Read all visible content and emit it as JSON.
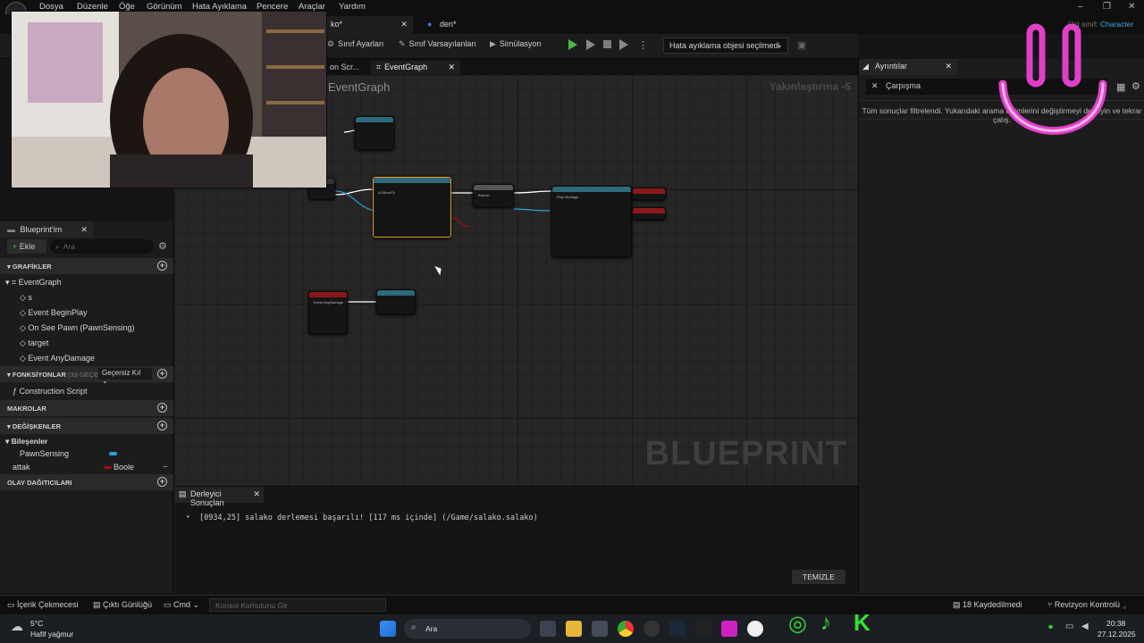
{
  "menubar": {
    "items": [
      "Dosya",
      "Düzenle",
      "Öğe",
      "Görünüm",
      "Hata Ayıklama",
      "Pencere",
      "Araçlar",
      "Yardım"
    ]
  },
  "tabs": {
    "asset_tab": "ko*",
    "den_tab": "den*",
    "parent_class_label": "Üst sınıf:",
    "parent_class_value": "Character"
  },
  "toolbar": {
    "class_settings": "Sınıf Ayarları",
    "class_defaults": "Sınıf Varsayılanları",
    "simulation": "Simülasyon",
    "debug_object": "Hata ayıklama objesi seçilmedi"
  },
  "graph_tabs": {
    "construction": "on Scr...",
    "event_graph": "EventGraph"
  },
  "graph": {
    "title": "EventGraph",
    "zoom": "Yakınlaştırma -5",
    "watermark": "BLUEPRINT",
    "nodes": {
      "event_begin_play": "Event AnyDamage",
      "ai_move_to": "AI MoveTo",
      "branch": "Branch",
      "play_montage": "Play Montage"
    }
  },
  "details": {
    "tab": "Ayrıntılar",
    "search": "Çarpışma",
    "message": "Tüm sonuçlar filtrelendi. Yukarıdaki arama terimlerini değiştirmeyi deneyin ve tekrar çalış."
  },
  "my_blueprint": {
    "tab": "Blueprint'im",
    "add": "Ekle",
    "search_placeholder": "Ara",
    "categories": {
      "graphs": "GRAFİKLER",
      "functions": "FONKSİYONLAR",
      "functions_count": "(33 GEÇERSİZ...",
      "override": "Geçersiz Kıl",
      "macros": "MAKROLAR",
      "variables": "DEĞİŞKENLER",
      "components": "Bileşenler",
      "dispatchers": "OLAY DAĞITICILARI"
    },
    "graph_items": [
      "EventGraph",
      "s",
      "Event BeginPlay",
      "On See Pawn (PawnSensing)",
      "target",
      "Event AnyDamage"
    ],
    "function_items": [
      "Construction Script"
    ],
    "component_items": [
      "PawnSensing"
    ],
    "variable_name": "attak",
    "variable_type": "Boole"
  },
  "compiler": {
    "tab": "Derleyici Sonuçları",
    "line": "[0934,25] salako derlemesi başarılı! [117 ms içinde] (/Game/salako.salako)",
    "clear": "TEMİZLE"
  },
  "statusbar": {
    "content_drawer": "İçerik Çekmecesi",
    "output_log": "Çıktı Günlüğü",
    "cmd": "Cmd",
    "console_placeholder": "Konsol Komutunu Gir",
    "unsaved": "18 Kaydedilmedi",
    "revision": "Revizyon Kontrolü"
  },
  "taskbar": {
    "temp": "5°C",
    "weather": "Hafif yağmur",
    "search": "Ara",
    "time": "20:38",
    "date": "27.12.2025"
  },
  "colors": {
    "accent_play": "#49b944",
    "smiley": "#e040c8",
    "exec": "#ffffff",
    "object_pin": "#2f9fd8",
    "bool_pin": "#a01010"
  }
}
